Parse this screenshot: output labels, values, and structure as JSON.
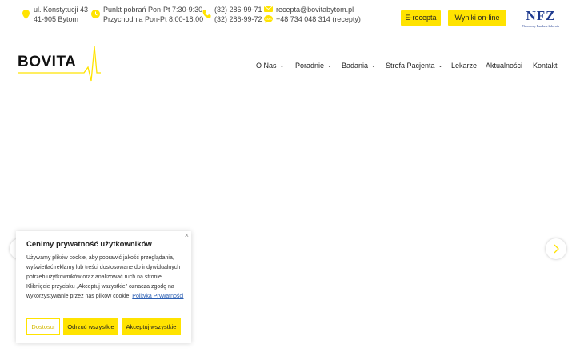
{
  "topbar": {
    "address_line1": "ul. Konstytucji 43",
    "address_line2": "41-905 Bytom",
    "hours_line1": "Punkt pobrań Pon-Pt 7:30-9:30",
    "hours_line2": "Przychodnia Pon-Pt 8:00-18:00",
    "phone1": "(32) 286-99-71",
    "phone2": "(32) 286-99-72",
    "email": "recepta@bovitabytom.pl",
    "sms": "+48 734 048 314 (recepty)",
    "erecepta_label": "E-recepta",
    "wyniki_label": "Wyniki on-line",
    "nfz_logo": "NFZ",
    "nfz_caption": "Narodowy Fundusz Zdrowia"
  },
  "header": {
    "logo_text": "BOVITA",
    "nav": [
      {
        "label": "O Nas",
        "dropdown": true
      },
      {
        "label": "Poradnie",
        "dropdown": true
      },
      {
        "label": "Badania",
        "dropdown": true
      },
      {
        "label": "Strefa Pacjenta",
        "dropdown": true
      },
      {
        "label": "Lekarze",
        "dropdown": false
      },
      {
        "label": "Aktualności",
        "dropdown": false
      },
      {
        "label": "Kontakt",
        "dropdown": false
      }
    ]
  },
  "cookie": {
    "title": "Cenimy prywatność użytkowników",
    "body": "Używamy plików cookie, aby poprawić jakość przeglądania, wyświetlać reklamy lub treści dostosowane do indywidualnych potrzeb użytkowników oraz analizować ruch na stronie. Kliknięcie przycisku „Akceptuj wszystkie” oznacza zgodę na wykorzystywanie przez nas plików cookie.",
    "policy_link": "Polityka Prywatności",
    "btn_customize": "Dostosuj",
    "btn_reject": "Odrzuć wszystkie",
    "btn_accept": "Akceptuj wszystkie",
    "close_symbol": "×"
  },
  "colors": {
    "accent_yellow": "#ffe300",
    "nfz_blue": "#1f3b8f"
  },
  "icons": [
    "location-pin-icon",
    "clock-icon",
    "phone-icon",
    "email-icon",
    "sms-icon",
    "chevron-left-icon",
    "chevron-right-icon"
  ]
}
